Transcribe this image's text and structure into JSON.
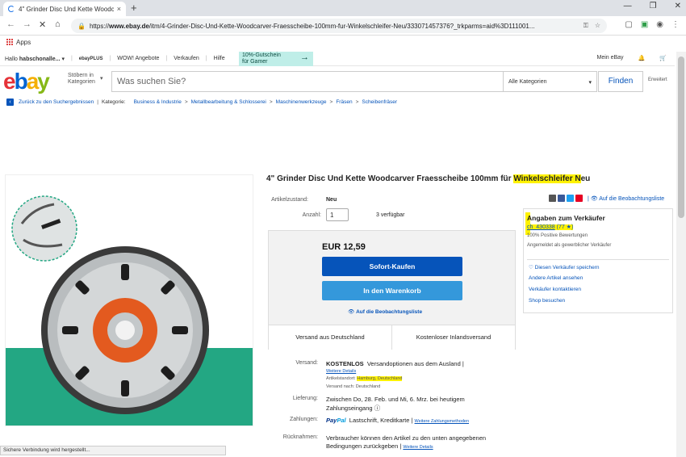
{
  "browser": {
    "tab_title": "4\" Grinder Disc Und Kette Woodc",
    "tab_close": "×",
    "new_tab": "+",
    "url_prefix": "https://",
    "url_host": "www.ebay.de",
    "url_path": "/itm/4-Grinder-Disc-Und-Kette-Woodcarver-Fraesscheibe-100mm-fur-Winkelschleifer-Neu/333071457376?_trkparms=aid%3D111001...",
    "bookmarks_apps": "Apps",
    "status_text": "Sichere Verbindung wird hergestellt..."
  },
  "topnav": {
    "greeting_prefix": "Hallo ",
    "greeting_name": "habschonalle...",
    "ebay_plus": "ebayPLUS",
    "items": [
      "WOW! Angebote",
      "Verkaufen",
      "Hilfe"
    ],
    "promo_line1": "10%-Gutschein",
    "promo_line2": "für Gamer",
    "my_ebay": "Mein eBay"
  },
  "header": {
    "logo": [
      "e",
      "b",
      "a",
      "y"
    ],
    "browse_line1": "Stöbern in",
    "browse_line2": "Kategorien",
    "search_placeholder": "Was suchen Sie?",
    "category_select": "Alle Kategorien",
    "find_button": "Finden",
    "advanced": "Erweitert"
  },
  "breadcrumb": {
    "back": "Zurück zu den Suchergebnissen",
    "category_label": "Kategorie:",
    "items": [
      "Business & Industrie",
      "Metallbearbeitung & Schlosserei",
      "Maschinenwerkzeuge",
      "Fräsen",
      "Scheibenfräser"
    ]
  },
  "product": {
    "title_part1": "4\" Grinder Disc Und Kette Woodcarver Fraesscheibe 100mm für ",
    "title_highlight": "Winkelschleifer N",
    "title_part2": "eu",
    "condition_label": "Artikelzustand:",
    "condition_value": "Neu",
    "quantity_label": "Anzahl:",
    "quantity_value": "1",
    "available": "3 verfügbar",
    "watchlist_top": "Auf die Beobachtungsliste"
  },
  "buybox": {
    "price": "EUR 12,59",
    "buy_now": "Sofort-Kaufen",
    "add_to_cart": "In den Warenkorb",
    "watchlist": "Auf die Beobachtungsliste",
    "ship_from": "Versand aus Deutschland",
    "free_shipping": "Kostenloser Inlandsversand"
  },
  "details": {
    "shipping_label": "Versand:",
    "shipping_value": "KOSTENLOS",
    "shipping_options": "Versandoptionen aus dem Ausland |",
    "more_details": "Weitere Details",
    "item_location_label": "Artikelstandort:",
    "item_location": "Hamburg, Deutschland",
    "ships_to_label": "Versand nach:",
    "ships_to": "Deutschland",
    "delivery_label": "Lieferung:",
    "delivery_value": "Zwischen Do, 28. Feb. und Mi, 6. Mrz. bei heutigem",
    "delivery_value2": "Zahlungseingang",
    "delivery_icon": "ⓘ",
    "payment_label": "Zahlungen:",
    "paypal_first": "Pay",
    "paypal_second": "Pal",
    "payment_methods": "Lastschrift,   Kreditkarte  |",
    "more_payment": "Weitere Zahlungsmethoden",
    "returns_label": "Rücknahmen:",
    "returns_value": "Verbraucher können den Artikel zu den unten angegebenen",
    "returns_value2": "Bedingungen zurückgeben |",
    "returns_more": "Weitere Details"
  },
  "seller": {
    "heading": "Angaben zum Verkäufer",
    "name": "ch_430338",
    "score": "(77 ★)",
    "positive": "100% Positive Bewertungen",
    "commercial": "Angemeldet als gewerblicher Verkäufer",
    "save_seller": "Diesen Verkäufer speichern",
    "other_items": "Andere Artikel ansehen",
    "contact": "Verkäufer kontaktieren",
    "visit_shop": "Shop besuchen"
  },
  "colors": {
    "ebay_red": "#e53238",
    "ebay_blue": "#0064d2",
    "ebay_yellow": "#f5af02",
    "ebay_green": "#86b817",
    "buy_blue": "#0654ba",
    "cart_blue": "#3498db",
    "highlight": "#fff200"
  }
}
